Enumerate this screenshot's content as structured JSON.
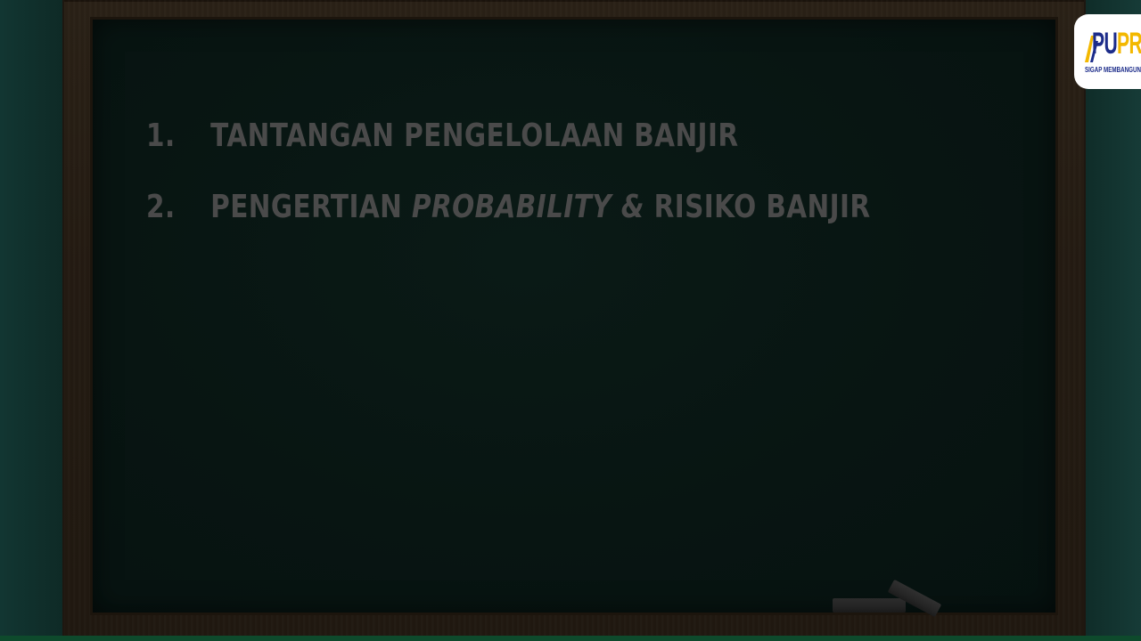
{
  "agenda": {
    "items": [
      {
        "number": "1.",
        "text_before": "TANTANGAN PENGELOLAAN BANJIR",
        "text_italic": "",
        "text_after": ""
      },
      {
        "number": "2.",
        "text_before": "PENGERTIAN ",
        "text_italic": "PROBABILITY &",
        "text_after": " RISIKO BANJIR"
      }
    ]
  },
  "logo": {
    "name_part1": "PU",
    "name_part2": "PR",
    "tagline": "SIGAP MEMBANGUN NEGERI",
    "colors": {
      "primary": "#1c2c8a",
      "accent": "#f3b800"
    }
  },
  "colors": {
    "chalkboard": "#081512",
    "frame": "#241b12",
    "chalk_text": "#4a4a4a",
    "wall": "#0e2925"
  },
  "icons": [
    "pupr-logo-mark",
    "chalk-eraser"
  ]
}
